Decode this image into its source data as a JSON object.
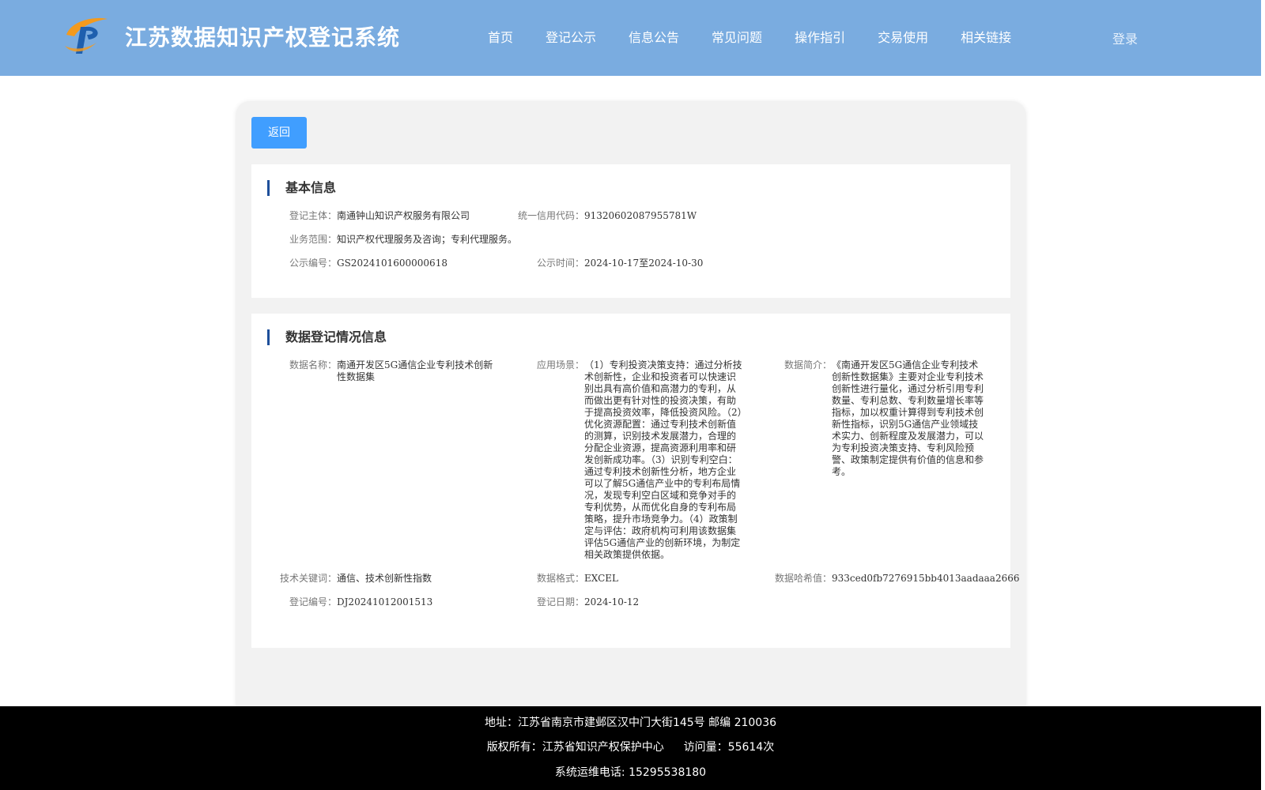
{
  "header": {
    "title": "江苏数据知识产权登记系统",
    "nav": [
      "首页",
      "登记公示",
      "信息公告",
      "常见问题",
      "操作指引",
      "交易使用",
      "相关链接"
    ],
    "login": "登录",
    "colors": {
      "bar": "#7aace0",
      "logo_orange": "#f39a1e",
      "logo_blue": "#1e5fae"
    }
  },
  "back_button": "返回",
  "basic_info": {
    "title": "基本信息",
    "subject_label": "登记主体：",
    "subject": "南通钟山知识产权服务有限公司",
    "credit_label": "统一信用代码：",
    "credit": "91320602087955781W",
    "scope_label": "业务范围：",
    "scope": "知识产权代理服务及咨询；专利代理服务。",
    "pub_no_label": "公示编号：",
    "pub_no": "GS2024101600000618",
    "pub_time_label": "公示时间：",
    "pub_time": "2024-10-17至2024-10-30"
  },
  "data_info": {
    "title": "数据登记情况信息",
    "name_label": "数据名称：",
    "name": "南通开发区5G通信企业专利技术创新性数据集",
    "scene_label": "应用场景：",
    "scene": "（1）专利投资决策支持：通过分析技术创新性，企业和投资者可以快速识别出具有高价值和高潜力的专利，从而做出更有针对性的投资决策，有助于提高投资效率，降低投资风险。（2）优化资源配置：通过专利技术创新值的测算，识别技术发展潜力，合理的分配企业资源，提高资源利用率和研发创新成功率。（3）识别专利空白：通过专利技术创新性分析，地方企业可以了解5G通信产业中的专利布局情况，发现专利空白区域和竞争对手的专利优势，从而优化自身的专利布局策略，提升市场竞争力。（4）政策制定与评估：政府机构可利用该数据集评估5G通信产业的创新环境，为制定相关政策提供依据。",
    "intro_label": "数据简介：",
    "intro": "《南通开发区5G通信企业专利技术创新性数据集》主要对企业专利技术创新性进行量化，通过分析引用专利数量、专利总数、专利数量增长率等指标，加以权重计算得到专利技术创新性指标，识别5G通信产业领域技术实力、创新程度及发展潜力，可以为专利投资决策支持、专利风险预警、政策制定提供有价值的信息和参考。",
    "keywords_label": "技术关键词：",
    "keywords": "通信、技术创新性指数",
    "format_label": "数据格式：",
    "format": "EXCEL",
    "hash_label": "数据哈希值：",
    "hash": "933ced0fb7276915bb4013aadaaa2666",
    "reg_no_label": "登记编号：",
    "reg_no": "DJ20241012001513",
    "reg_date_label": "登记日期：",
    "reg_date": "2024-10-12"
  },
  "footer": {
    "address": "地址：江苏省南京市建邺区汉中门大街145号 邮编 210036",
    "copyright": "版权所有：江苏省知识产权保护中心",
    "visits": "访问量：55614次",
    "phone": "系统运维电话: 15295538180"
  }
}
